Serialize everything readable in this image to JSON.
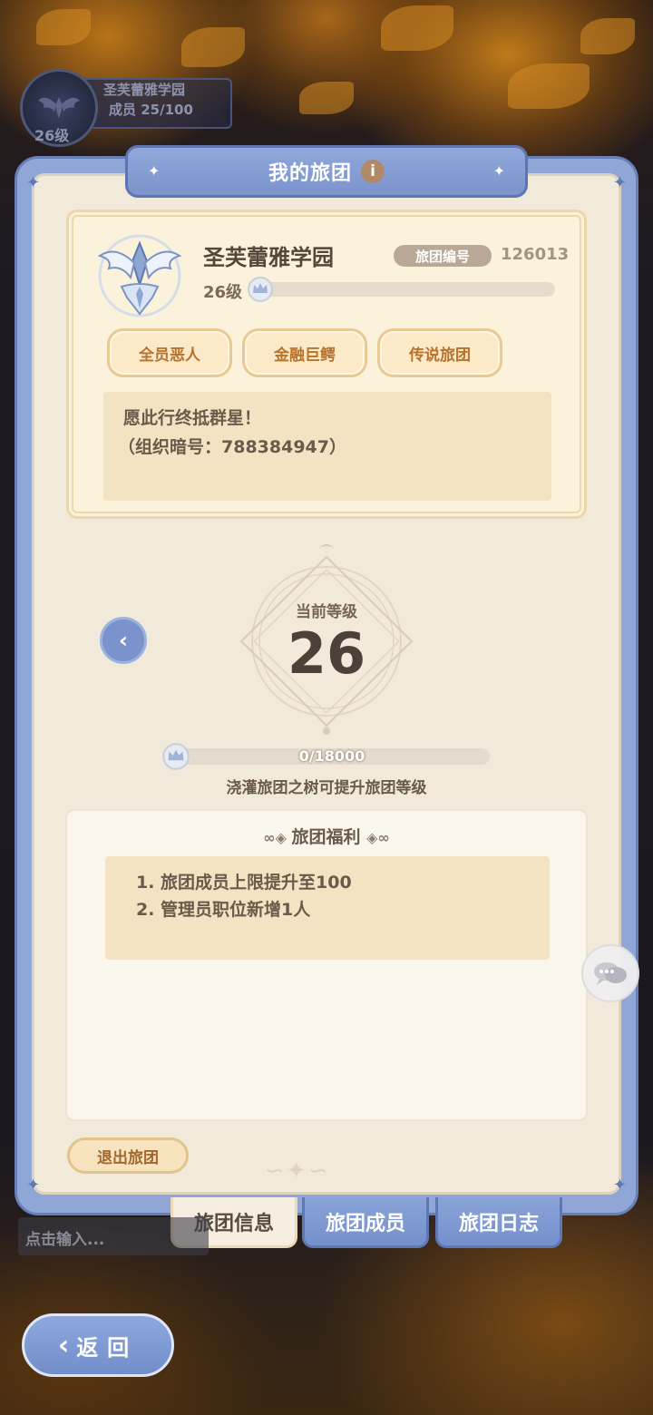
{
  "guild_badge": {
    "name": "圣芙蕾雅学园",
    "members": "成员   25/100",
    "level": "26级"
  },
  "panel": {
    "title": "我的旅团",
    "info_icon": "info-icon"
  },
  "card": {
    "guild_name": "圣芙蕾雅学园",
    "id_label": "旅团编号",
    "id_value": "126013",
    "level_label": "26级",
    "level_progress": 0,
    "tags": [
      "全员恶人",
      "金融巨鳄",
      "传说旅团"
    ],
    "motto_line1": "愿此行终抵群星！",
    "motto_line2": "（组织暗号：788384947）"
  },
  "level": {
    "label": "当前等级",
    "value": "26",
    "exp_text": "0/18000",
    "exp_progress": 0,
    "hint": "浇灌旅团之树可提升旅团等级"
  },
  "benefits": {
    "title": "旅团福利",
    "items": [
      "1.  旅团成员上限提升至100",
      "2.  管理员职位新增1人"
    ]
  },
  "actions": {
    "leave": "退出旅团"
  },
  "tabs": [
    {
      "label": "旅团信息",
      "active": true
    },
    {
      "label": "旅团成员",
      "active": false
    },
    {
      "label": "旅团日志",
      "active": false
    }
  ],
  "chat": {
    "placeholder": "点击输入..."
  },
  "back": {
    "label": "返回"
  },
  "colors": {
    "panel_blue": "#8fa6d6",
    "card_cream": "#fbf2dc",
    "tag_text": "#b8722c",
    "text_brown": "#6a5a4b"
  }
}
